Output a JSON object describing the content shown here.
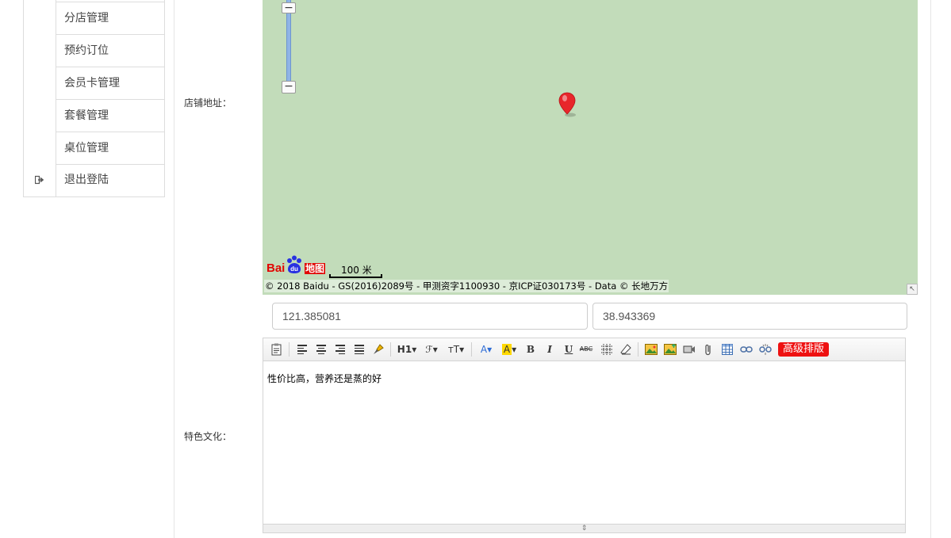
{
  "sidebar": {
    "items": [
      {
        "label": "分店管理"
      },
      {
        "label": "预约订位"
      },
      {
        "label": "会员卡管理"
      },
      {
        "label": "套餐管理"
      },
      {
        "label": "桌位管理"
      }
    ],
    "logout": {
      "label": "退出登陆",
      "icon": "sign-out-icon"
    }
  },
  "form": {
    "address_label": "店铺地址：",
    "culture_label": "特色文化："
  },
  "map": {
    "background_color": "#c2dcba",
    "logo_text_bai": "Bai",
    "logo_text_du": "du",
    "logo_text_ditu": "地图",
    "scale_label": "100 米",
    "copyright": "© 2018 Baidu - GS(2016)2089号 - 甲测资字1100930 - 京ICP证030173号 - Data © 长地万方",
    "zoom_in": "−",
    "zoom_out": "−"
  },
  "coordinates": {
    "longitude": "121.385081",
    "latitude": "38.943369"
  },
  "editor": {
    "toolbar": {
      "heading": "H1",
      "font_family": "ℱ",
      "font_size": "тT",
      "font_color": "A",
      "highlight": "A",
      "bold": "B",
      "italic": "I",
      "underline": "U",
      "strikethrough": "ABC",
      "advanced_layout": "高级排版"
    },
    "content": "性价比高，营养还是蒸的好"
  },
  "colors": {
    "accent_red": "#ee1111",
    "map_green": "#c2dcba",
    "border": "#dddddd"
  }
}
